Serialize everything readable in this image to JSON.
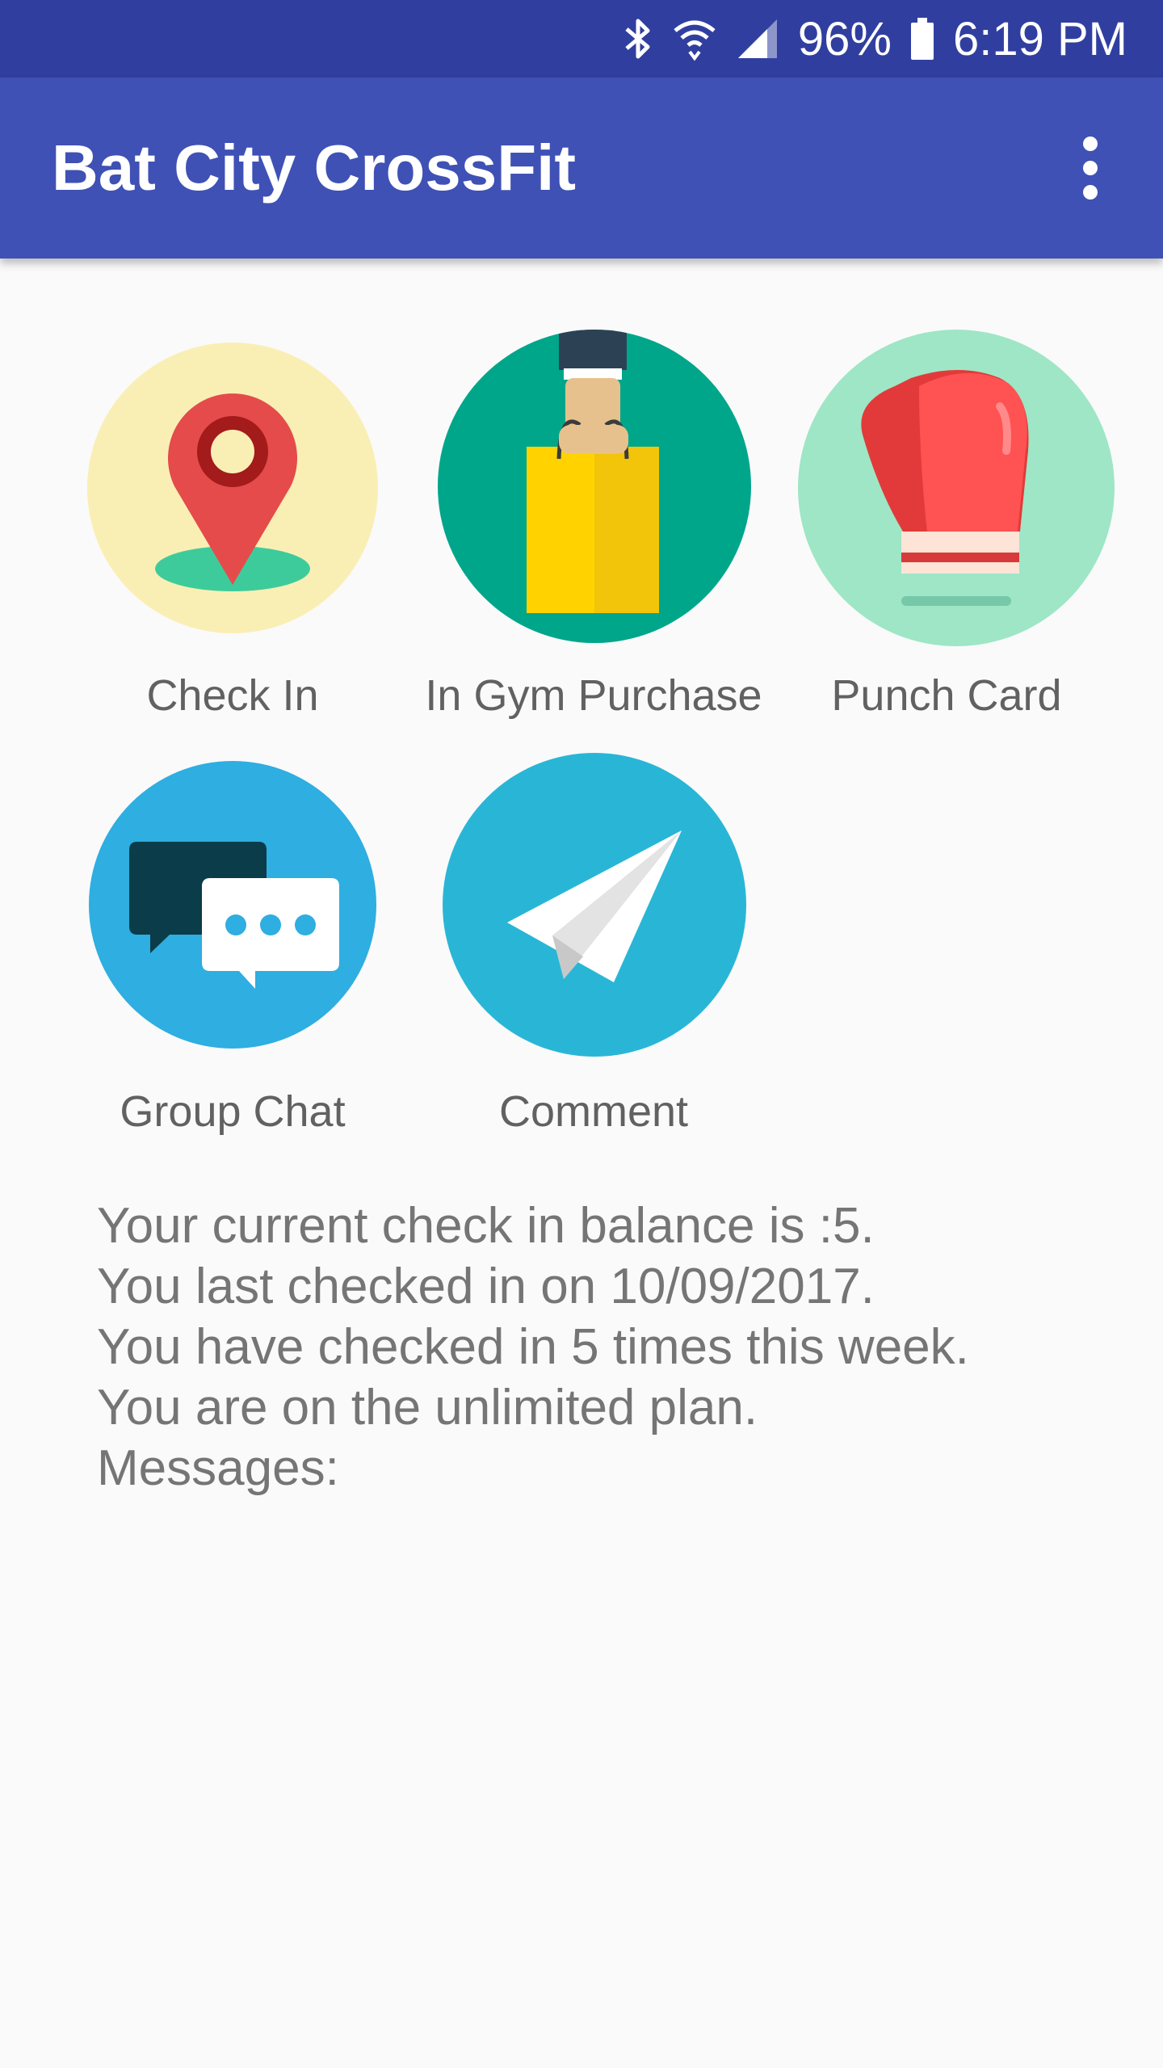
{
  "status_bar": {
    "battery": "96%",
    "time": "6:19 PM",
    "icons": [
      "bluetooth-icon",
      "wifi-icon",
      "cell-signal-icon",
      "battery-icon"
    ]
  },
  "app_bar": {
    "title": "Bat City CrossFit",
    "menu_icon": "more-vert-icon"
  },
  "colors": {
    "status_bar": "#303f9f",
    "app_bar": "#3f51b5",
    "background": "#fafafa",
    "label_text": "#616161",
    "info_text": "#757575"
  },
  "tiles": [
    {
      "label": "Check In",
      "icon": "map-pin-icon",
      "bg": "#f9efb4"
    },
    {
      "label": "In Gym Purchase",
      "icon": "shopping-bag-icon",
      "bg": "#00a68a"
    },
    {
      "label": "Punch Card",
      "icon": "boxing-glove-icon",
      "bg": "#9ee6c6"
    },
    {
      "label": "Group Chat",
      "icon": "chat-bubbles-icon",
      "bg": "#2eaee1"
    },
    {
      "label": "Comment",
      "icon": "paper-plane-icon",
      "bg": "#29b6d6"
    }
  ],
  "info": {
    "balance": "Your current check in balance is :5.",
    "last_checkin": "You last checked in on 10/09/2017.",
    "weekly": "You have checked in 5 times this week.",
    "plan": "You are on the unlimited plan.",
    "messages": "Messages:"
  }
}
